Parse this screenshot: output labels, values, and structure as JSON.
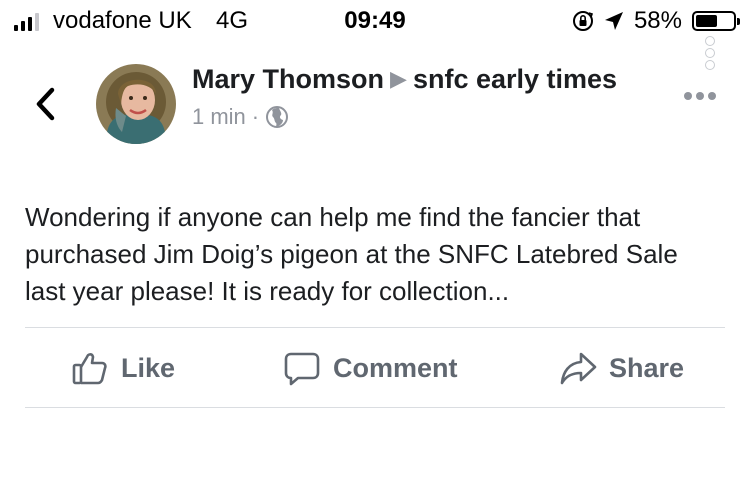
{
  "status_bar": {
    "carrier": "vodafone UK",
    "network": "4G",
    "time": "09:49",
    "battery_percent": "58%",
    "battery_level": 0.58,
    "signal_bars_filled": 3,
    "icons": [
      "signal-icon",
      "rotation-lock-icon",
      "location-arrow-icon",
      "battery-icon"
    ]
  },
  "post": {
    "author": "Mary Thomson",
    "group": "snfc early times",
    "timestamp": "1 min",
    "separator": "·",
    "privacy_icon": "globe-icon",
    "text": "Wondering if anyone can help me find the fancier that purchased Jim Doig’s pigeon at the SNFC Latebred Sale last year please! It is ready for collection..."
  },
  "actions": {
    "like_label": "Like",
    "comment_label": "Comment",
    "share_label": "Share"
  },
  "colors": {
    "text": "#1c1e21",
    "secondary": "#90949c",
    "action": "#606770",
    "divider": "#dadde1"
  }
}
